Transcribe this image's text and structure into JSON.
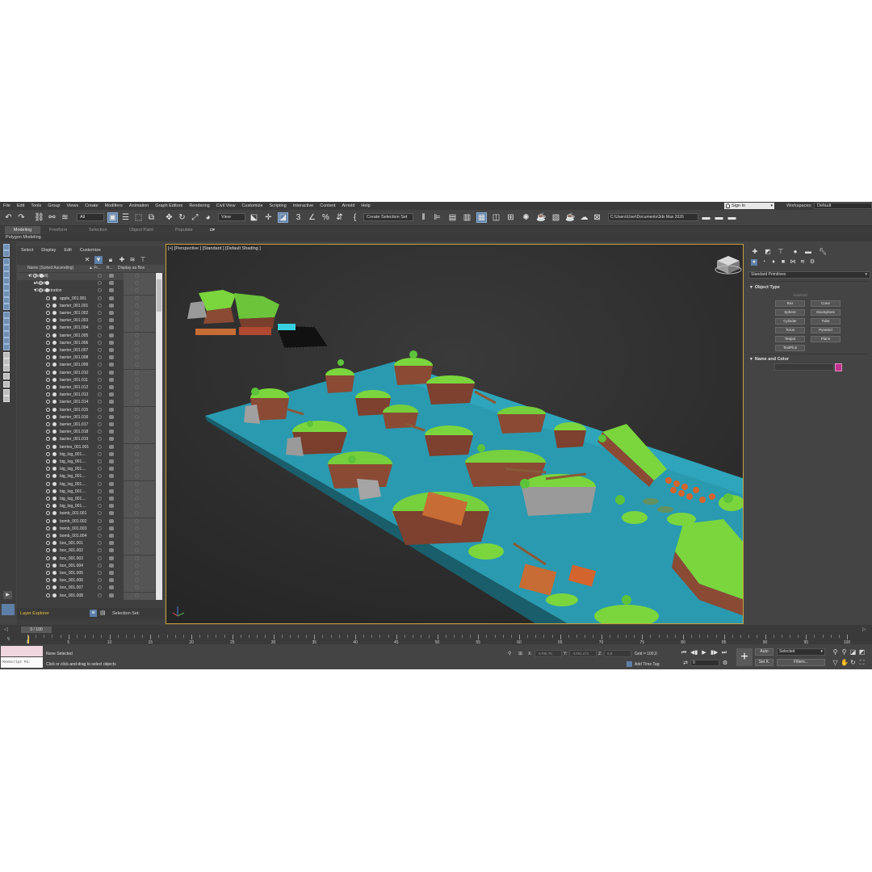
{
  "menu": [
    "File",
    "Edit",
    "Tools",
    "Group",
    "Views",
    "Create",
    "Modifiers",
    "Animation",
    "Graph Editors",
    "Rendering",
    "Civil View",
    "Customize",
    "Scripting",
    "Interactive",
    "Content",
    "Arnold",
    "Help"
  ],
  "account": {
    "sign_in": "Sign In",
    "workspaces_label": "Workspaces:",
    "workspace": "Default"
  },
  "toolbar": {
    "filter_select": "All",
    "view_select": "View",
    "create_selection_set": "Create Selection Set",
    "project_path": "C:\\Users\\User\\Documents\\3ds Max 2026"
  },
  "ribbon": {
    "tabs": [
      "Modeling",
      "Freeform",
      "Selection",
      "Object Paint",
      "Populate"
    ],
    "active_tab": "Modeling",
    "sub": "Polygon Modeling"
  },
  "explorer": {
    "menu": [
      "Select",
      "Display",
      "Edit",
      "Customize"
    ],
    "columns": {
      "name": "Name (Sorted Ascending)",
      "frozen": "▲ Fr...",
      "render": "R...",
      "display_as_box": "Display as Box"
    },
    "rows": [
      {
        "name": "0 (default)",
        "level": 0
      },
      {
        "name": "Assets",
        "level": 1
      },
      {
        "name": "Demonstration",
        "level": 1
      },
      {
        "name": "apple_001.001",
        "level": 2
      },
      {
        "name": "barrier_001.001",
        "level": 2
      },
      {
        "name": "barrier_001.002",
        "level": 2
      },
      {
        "name": "barrier_001.003",
        "level": 2
      },
      {
        "name": "barrier_001.004",
        "level": 2
      },
      {
        "name": "barrier_001.005",
        "level": 2
      },
      {
        "name": "barrier_001.006",
        "level": 2
      },
      {
        "name": "barrier_001.007",
        "level": 2
      },
      {
        "name": "barrier_001.008",
        "level": 2
      },
      {
        "name": "barrier_001.009",
        "level": 2
      },
      {
        "name": "barrier_001.010",
        "level": 2
      },
      {
        "name": "barrier_001.011",
        "level": 2
      },
      {
        "name": "barrier_001.012",
        "level": 2
      },
      {
        "name": "barrier_001.013",
        "level": 2
      },
      {
        "name": "barrier_001.014",
        "level": 2
      },
      {
        "name": "barrier_001.015",
        "level": 2
      },
      {
        "name": "barrier_001.016",
        "level": 2
      },
      {
        "name": "barrier_001.017",
        "level": 2
      },
      {
        "name": "barrier_001.018",
        "level": 2
      },
      {
        "name": "barrier_001.019",
        "level": 2
      },
      {
        "name": "berries_001.001",
        "level": 2
      },
      {
        "name": "big_log_001....",
        "level": 2
      },
      {
        "name": "big_log_001....",
        "level": 2
      },
      {
        "name": "big_log_001....",
        "level": 2
      },
      {
        "name": "big_log_001....",
        "level": 2
      },
      {
        "name": "big_log_001....",
        "level": 2
      },
      {
        "name": "big_log_001....",
        "level": 2
      },
      {
        "name": "big_log_001....",
        "level": 2
      },
      {
        "name": "big_log_001....",
        "level": 2
      },
      {
        "name": "bomb_001.001",
        "level": 2
      },
      {
        "name": "bomb_001.002",
        "level": 2
      },
      {
        "name": "bomb_001.003",
        "level": 2
      },
      {
        "name": "bomb_001.004",
        "level": 2
      },
      {
        "name": "box_001.001",
        "level": 2
      },
      {
        "name": "box_001.002",
        "level": 2
      },
      {
        "name": "box_001.003",
        "level": 2
      },
      {
        "name": "box_001.004",
        "level": 2
      },
      {
        "name": "box_001.005",
        "level": 2
      },
      {
        "name": "box_001.006",
        "level": 2
      },
      {
        "name": "box_001.007",
        "level": 2
      },
      {
        "name": "box_001.008",
        "level": 2
      },
      {
        "name": "box_001.009",
        "level": 2
      }
    ],
    "footer": {
      "layer_explorer": "Layer Explorer",
      "selection_set": "Selection Set:"
    }
  },
  "viewport": {
    "label": "[+] [Perspective ] [Standard ] [Default Shading ]"
  },
  "command_panel": {
    "category": "Standard Primitives",
    "object_type_title": "Object Type",
    "autogrid": "AutoGrid",
    "buttons": [
      "Box",
      "Cone",
      "Sphere",
      "GeoSphere",
      "Cylinder",
      "Tube",
      "Torus",
      "Pyramid",
      "Teapot",
      "Plane",
      "TextPlus"
    ],
    "name_color_title": "Name and Color",
    "object_color": "#c1308f"
  },
  "time": {
    "frame": "0 / 100",
    "ticks": [
      "0",
      "5",
      "10",
      "15",
      "20",
      "25",
      "30",
      "35",
      "40",
      "45",
      "50",
      "55",
      "60",
      "65",
      "70",
      "75",
      "80",
      "85",
      "90",
      "95",
      "100"
    ]
  },
  "status": {
    "maxscript": "MAXScript Mi:",
    "selected": "None Selected",
    "prompt": "Click or click-and-drag to select objects",
    "x_label": "X:",
    "x_value": "-1705,78",
    "y_label": "Y:",
    "y_value": "-1761,471",
    "z_label": "Z:",
    "z_value": "0,0",
    "grid": "Grid = 100,0",
    "add_time_tag": "Add Time Tag",
    "frame_field": "0",
    "auto": "Auto",
    "set_k": "Set K.",
    "selected_dd": "Selected",
    "filters": "Filters..."
  }
}
